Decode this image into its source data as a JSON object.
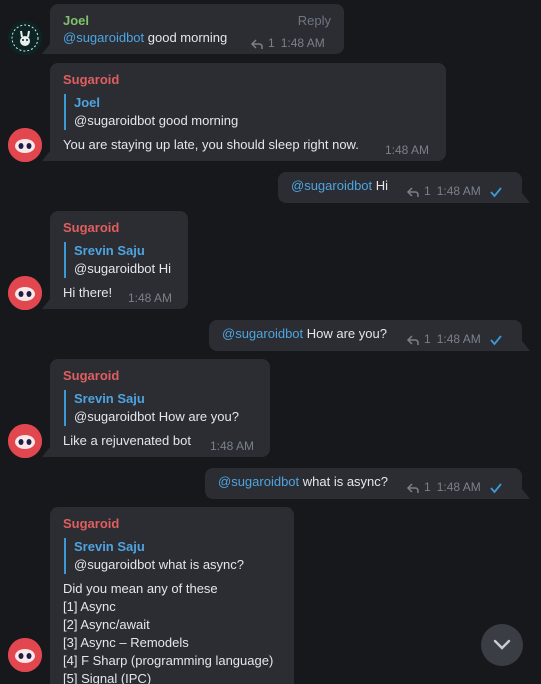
{
  "messages": {
    "m1": {
      "sender": "Joel",
      "reply_link": "Reply",
      "mention": "@sugaroidbot",
      "text": " good morning",
      "reply_count": "1",
      "time": "1:48 AM"
    },
    "m2": {
      "sender": "Sugaroid",
      "quote_name": "Joel",
      "quote_text": "@sugaroidbot good morning",
      "text": "You are staying up late, you should sleep right now.",
      "time": "1:48 AM"
    },
    "m3": {
      "mention": "@sugaroidbot",
      "text": " Hi",
      "reply_count": "1",
      "time": "1:48 AM"
    },
    "m4": {
      "sender": "Sugaroid",
      "quote_name": "Srevin Saju",
      "quote_text": "@sugaroidbot Hi",
      "text": "Hi there!",
      "time": "1:48 AM"
    },
    "m5": {
      "mention": "@sugaroidbot",
      "text": " How are you?",
      "reply_count": "1",
      "time": "1:48 AM"
    },
    "m6": {
      "sender": "Sugaroid",
      "quote_name": "Srevin Saju",
      "quote_text": "@sugaroidbot How are you?",
      "text": "Like a rejuvenated bot",
      "time": "1:48 AM"
    },
    "m7": {
      "mention": "@sugaroidbot",
      "text": " what is async?",
      "reply_count": "1",
      "time": "1:48 AM"
    },
    "m8": {
      "sender": "Sugaroid",
      "quote_name": "Srevin Saju",
      "quote_text": "@sugaroidbot what is async?",
      "intro": "Did you mean any of these",
      "options": [
        "[1] Async",
        "[2] Async/await",
        "[3] Async – Remodels",
        "[4] F Sharp (programming language)",
        "[5] Signal (IPC)"
      ]
    }
  },
  "colors": {
    "background": "#17181c",
    "bubble": "#2b2d33",
    "mention": "#4ea4e0",
    "joel_name": "#7fc26c",
    "sugaroid_name": "#e05e5e",
    "check": "#3d9ad8"
  },
  "icons": {
    "reply": "reply-arrow-icon",
    "check": "check-icon",
    "scroll": "chevron-down-icon"
  }
}
